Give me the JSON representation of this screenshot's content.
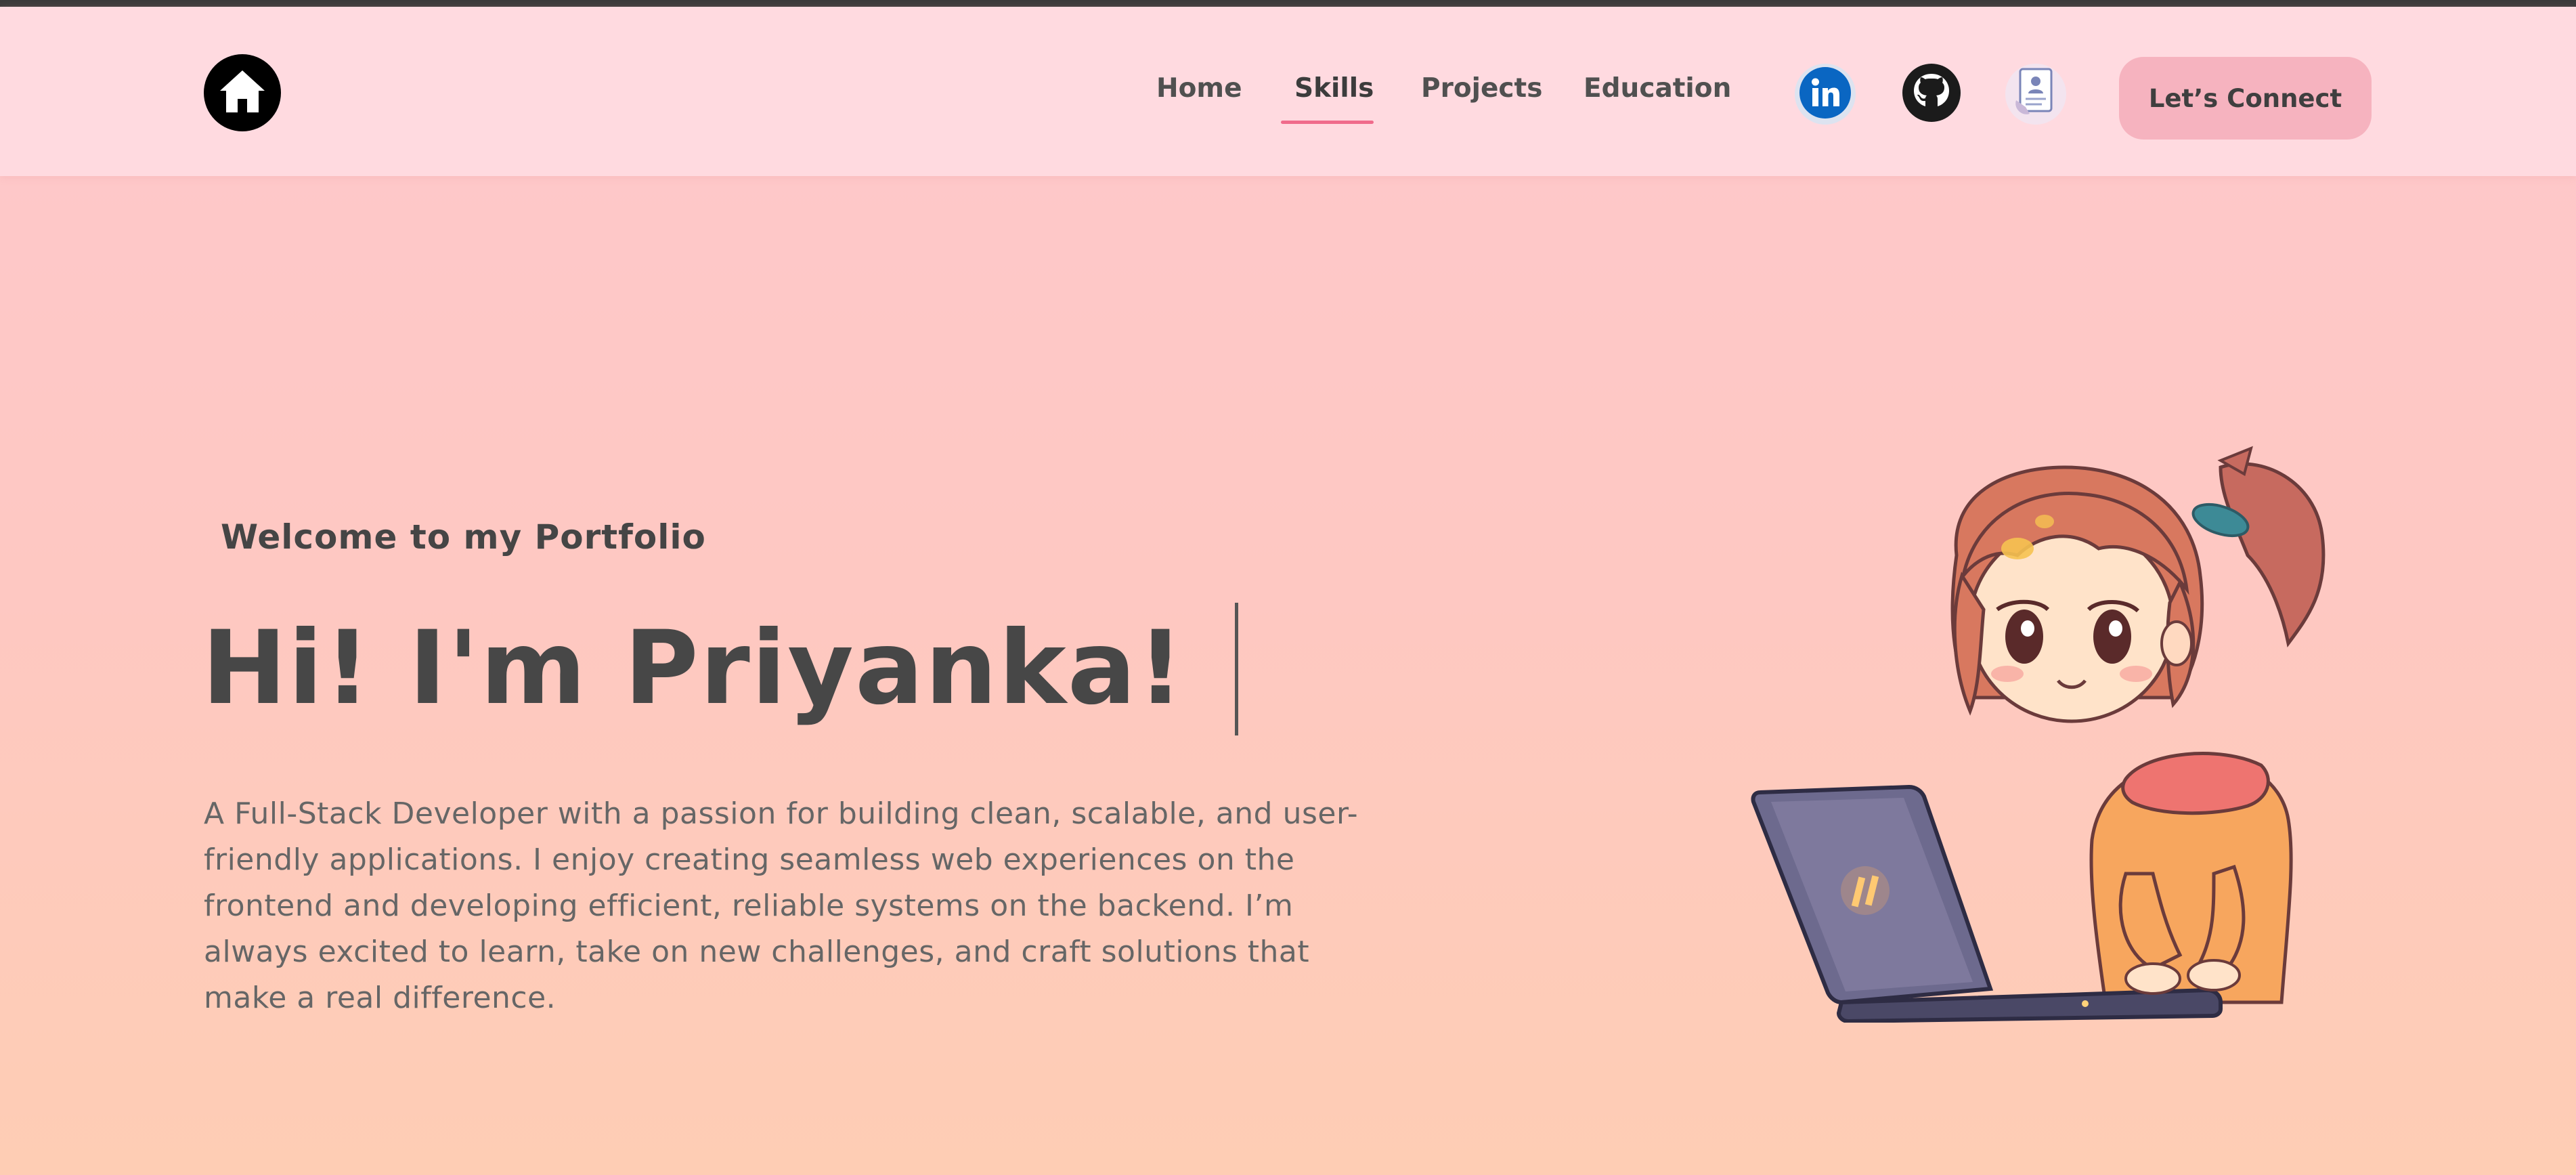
{
  "nav": {
    "logo_icon": "home-icon",
    "links": [
      "Home",
      "Skills",
      "Projects",
      "Education"
    ],
    "active": "Skills",
    "social": [
      {
        "name": "linkedin-icon",
        "label": "in"
      },
      {
        "name": "github-icon"
      },
      {
        "name": "resume-icon"
      }
    ],
    "connect_label": "Let’s Connect"
  },
  "hero": {
    "welcome": "Welcome to my Portfolio",
    "title": "Hi! I'm Priyanka!",
    "description": "A Full-Stack Developer with a passion for building clean, scalable, and user-friendly applications. I enjoy creating seamless web experiences on the frontend and developing efficient, reliable systems on the backend. I’m always excited to learn, take on new challenges, and craft solutions that make a real difference."
  },
  "colors": {
    "accent": "#f06b8b",
    "button": "#f6b3bf",
    "navbar": "#ffdae0",
    "linkedin": "#0a66c2"
  }
}
